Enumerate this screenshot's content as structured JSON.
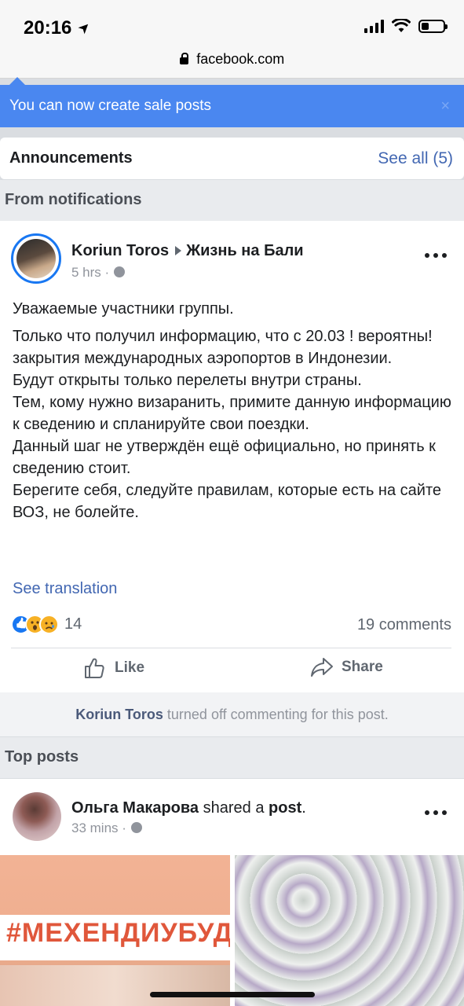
{
  "status_bar": {
    "time": "20:16"
  },
  "browser": {
    "url": "facebook.com"
  },
  "banner": {
    "text": "You can now create sale posts",
    "close": "×"
  },
  "announcements": {
    "title": "Announcements",
    "link": "See all (5)"
  },
  "sections": {
    "from_notifications": "From notifications",
    "top_posts": "Top posts"
  },
  "post1": {
    "author": "Koriun Toros",
    "group": "Жизнь на Бали",
    "time": "5 hrs ·",
    "paragraphs": [
      "Уважаемые участники группы.",
      "Только что получил информацию, что с 20.03 ! вероятны! закрытия международных аэропортов в Индонезии.\nБудут открыты только перелеты внутри страны.\nТем, кому нужно визаранить, примите данную информацию к сведению и спланируйте свои поездки.\nДанный шаг не утверждён ещё официально, но принять к сведению стоит.\nБерегите себя, следуйте правилам, которые есть на сайте ВОЗ, не болейте."
    ],
    "see_translation": "See translation",
    "reaction_count": "14",
    "comments": "19 comments",
    "like_label": "Like",
    "share_label": "Share",
    "comment_off_name": "Koriun Toros",
    "comment_off_text": " turned off commenting for this post."
  },
  "post2": {
    "author": "Ольга Макарова",
    "shared": " shared a ",
    "post_word": "post",
    "period": ".",
    "time": "33 mins ·",
    "image_text": "#МЕХЕНДИУБУД"
  },
  "colors": {
    "link": "#4267b2",
    "banner": "#4a87f0",
    "like": "#1877f2"
  }
}
